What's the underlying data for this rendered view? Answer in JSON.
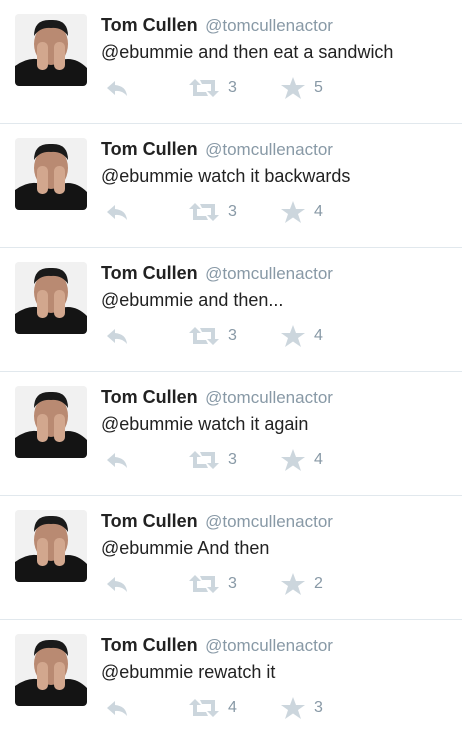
{
  "tweets": [
    {
      "name": "Tom Cullen",
      "handle": "@tomcullenactor",
      "text": "@ebummie and then eat a sandwich",
      "retweets": "3",
      "favorites": "5"
    },
    {
      "name": "Tom Cullen",
      "handle": "@tomcullenactor",
      "text": "@ebummie watch it backwards",
      "retweets": "3",
      "favorites": "4"
    },
    {
      "name": "Tom Cullen",
      "handle": "@tomcullenactor",
      "text": "@ebummie and then...",
      "retweets": "3",
      "favorites": "4"
    },
    {
      "name": "Tom Cullen",
      "handle": "@tomcullenactor",
      "text": "@ebummie watch it again",
      "retweets": "3",
      "favorites": "4"
    },
    {
      "name": "Tom Cullen",
      "handle": "@tomcullenactor",
      "text": "@ebummie And then",
      "retweets": "3",
      "favorites": "2"
    },
    {
      "name": "Tom Cullen",
      "handle": "@tomcullenactor",
      "text": "@ebummie rewatch it",
      "retweets": "4",
      "favorites": "3"
    }
  ],
  "icons": {
    "reply": "reply-icon",
    "retweet": "retweet-icon",
    "favorite": "star-icon"
  },
  "colors": {
    "icon_gray": "#ccd6dd",
    "count_gray": "#8899a6",
    "handle_gray": "#8899a6",
    "divider": "#e1e8ed"
  }
}
